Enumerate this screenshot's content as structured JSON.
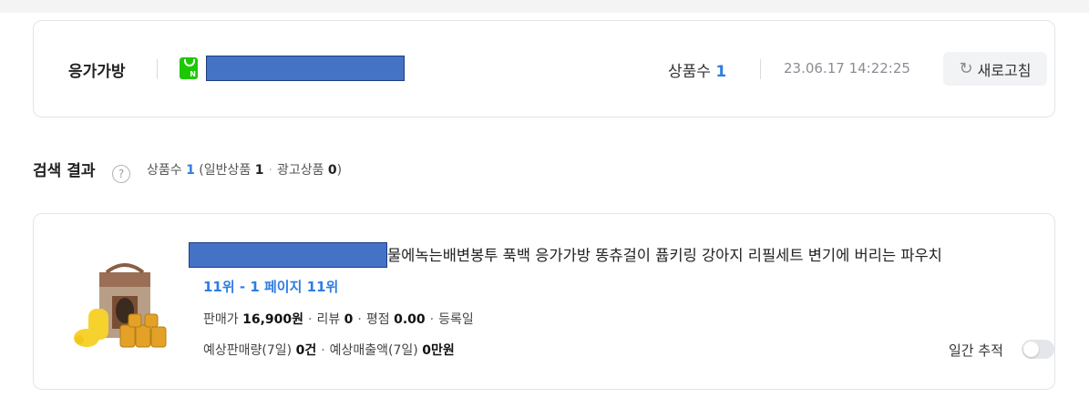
{
  "header": {
    "keyword": "응가가방",
    "product_count_label": "상품수",
    "product_count": "1",
    "timestamp": "23.06.17 14:22:25",
    "refresh_label": "새로고침",
    "store_icon": "naver-smartstore-icon",
    "refresh_icon": "refresh-icon"
  },
  "search_results": {
    "title": "검색 결과",
    "help_icon": "question-circle-icon",
    "count_label": "상품수",
    "count": "1",
    "general_label": "(일반상품",
    "general_count": "1",
    "ad_label": "광고상품",
    "ad_count": "0",
    "close_paren": ")"
  },
  "product": {
    "title": "물에녹는배변봉투 푹백 응가가방 똥츄걸이 퓹키링 강아지 리필세트 변기에 버리는 파우치",
    "rank": "11위 - 1 페이지 11위",
    "price_label": "판매가",
    "price": "16,900원",
    "review_label": "리뷰",
    "review_count": "0",
    "rating_label": "평점",
    "rating": "0.00",
    "registered_label": "등록일",
    "est_sales_label": "예상판매량(7일)",
    "est_sales": "0건",
    "est_revenue_label": "예상매출액(7일)",
    "est_revenue": "0만원",
    "daily_track_label": "일간 추적",
    "daily_track_on": false
  },
  "colors": {
    "accent": "#2f7de1",
    "naver_green": "#1ec800",
    "redaction": "#4472c4"
  }
}
